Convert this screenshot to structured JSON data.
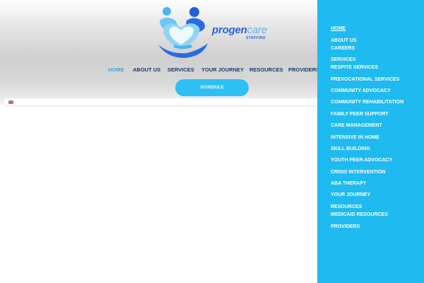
{
  "brand": {
    "name_main": "progen",
    "name_accent": "care",
    "tagline": "STAFFING"
  },
  "nav": {
    "home": "HOME",
    "about": "ABOUT US",
    "services": "SERVICES",
    "journey": "YOUR JOURNEY",
    "resources": "RESOURCES",
    "providers": "PROVIDERS"
  },
  "schedule_label": "SCHEDULE",
  "language_icon": "uk-flag-icon",
  "side_menu": {
    "home": "HOME",
    "about": "ABOUT US",
    "careers": "CAREERS",
    "services": "SERVICES",
    "respite": "RESPITE SERVICES",
    "prevocational": "PREVOCATIONAL SERVICES",
    "community_advocacy": "COMMUNITY ADVOCACY",
    "community_rehab": "COMMUNITY REHABILITATION",
    "family_peer": "FAMILY PEER SUPPORT",
    "care_mgmt": "CARE MANAGEMENT",
    "intensive": "INTENSIVE IN HOME",
    "skill": "SKILL BUILDING",
    "youth_peer": "YOUTH PEER ADVOCACY",
    "crisis": "CRISIS INTERVENTION",
    "aba": "ABA THERAPY",
    "journey": "YOUR JOURNEY",
    "resources": "RESOURCES",
    "medicaid": "MEDICAID RESOURCES",
    "providers": "PROVIDERS"
  },
  "colors": {
    "accent": "#1ebaf0",
    "nav_text": "#1b3a6b",
    "brand_blue": "#2b5fd8"
  }
}
